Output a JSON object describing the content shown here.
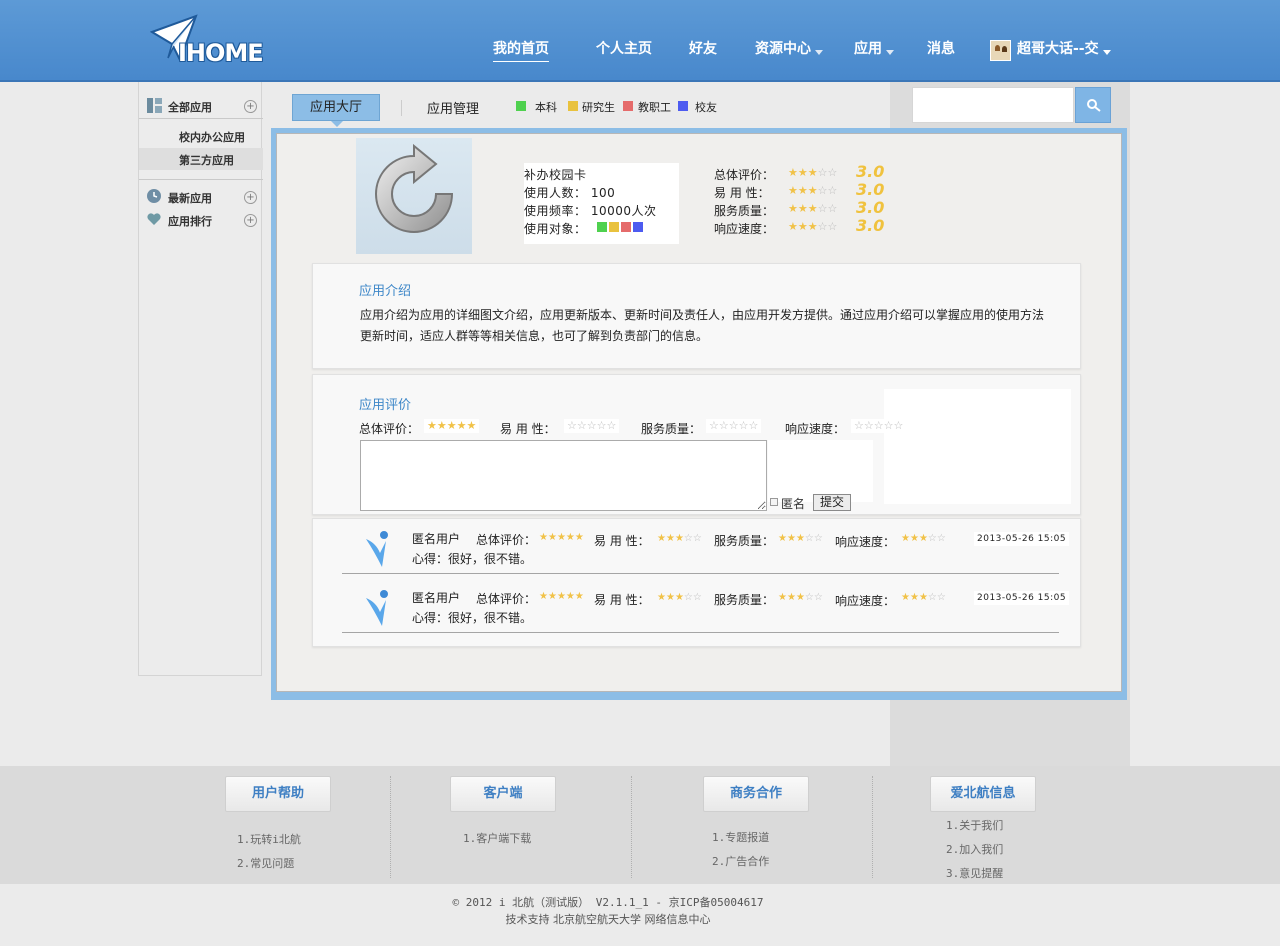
{
  "header": {
    "nav": [
      {
        "label": "我的首页",
        "active": true
      },
      {
        "label": "个人主页"
      },
      {
        "label": "好友"
      },
      {
        "label": "资源中心",
        "dropdown": true
      },
      {
        "label": "应用",
        "dropdown": true
      },
      {
        "label": "消息"
      }
    ],
    "logo_text": "IHOME",
    "user_name": "超哥大话--交",
    "colors": {
      "bar": "#4a8ad0",
      "accent": "#8cbde6"
    }
  },
  "sidebar": {
    "all_apps": "全部应用",
    "sub_items": [
      "校内办公应用",
      "第三方应用"
    ],
    "new_apps": "最新应用",
    "ranking": "应用排行"
  },
  "tabs": {
    "hall": "应用大厅",
    "manage": "应用管理",
    "legend": [
      {
        "label": "本科",
        "color": "#4fd14f"
      },
      {
        "label": "研究生",
        "color": "#e9c23e"
      },
      {
        "label": "教职工",
        "color": "#e56b6b"
      },
      {
        "label": "校友",
        "color": "#4d5bf0"
      }
    ]
  },
  "app": {
    "name": "补办校园卡",
    "users_label": "使用人数：",
    "users_value": "100",
    "freq_label": "使用频率：",
    "freq_value": "10000人次",
    "target_label": "使用对象：",
    "ratings": [
      {
        "label": "总体评价：",
        "stars": 3,
        "score": "3.0"
      },
      {
        "label": "易 用 性：",
        "stars": 3,
        "score": "3.0"
      },
      {
        "label": "服务质量：",
        "stars": 3,
        "score": "3.0"
      },
      {
        "label": "响应速度：",
        "stars": 3,
        "score": "3.0"
      }
    ]
  },
  "intro": {
    "title": "应用介绍",
    "text": "应用介绍为应用的详细图文介绍，应用更新版本、更新时间及责任人，由应用开发方提供。通过应用介绍可以掌握应用的使用方法更新时间，适应人群等等相关信息，也可了解到负责部门的信息。"
  },
  "evaluation": {
    "title": "应用评价",
    "fields": [
      {
        "label": "总体评价：",
        "stars": 5
      },
      {
        "label": "易 用 性：",
        "stars": 0
      },
      {
        "label": "服务质量：",
        "stars": 0
      },
      {
        "label": "响应速度：",
        "stars": 0
      }
    ],
    "anonymous_label": "匿名",
    "submit_label": "提交"
  },
  "reviews": [
    {
      "user": "匿名用户",
      "overall_label": "总体评价：",
      "overall": 5,
      "usability_label": "易 用 性：",
      "usability": 3,
      "service_label": "服务质量：",
      "service": 3,
      "speed_label": "响应速度：",
      "speed": 3,
      "time": "2013-05-26 15:05",
      "body": "心得：很好，很不错。"
    },
    {
      "user": "匿名用户",
      "overall_label": "总体评价：",
      "overall": 5,
      "usability_label": "易 用 性：",
      "usability": 3,
      "service_label": "服务质量：",
      "service": 3,
      "speed_label": "响应速度：",
      "speed": 3,
      "time": "2013-05-26 15:05",
      "body": "心得：很好，很不错。"
    }
  ],
  "footer": {
    "columns": [
      {
        "title": "用户帮助",
        "links": [
          "1.玩转i北航",
          "2.常见问题"
        ]
      },
      {
        "title": "客户端",
        "links": [
          "1.客户端下载"
        ]
      },
      {
        "title": "商务合作",
        "links": [
          "1.专题报道",
          "2.广告合作"
        ]
      },
      {
        "title": "爱北航信息",
        "links": [
          "1.关于我们",
          "2.加入我们",
          "3.意见提醒"
        ]
      }
    ],
    "copyright": "© 2012 i 北航（测试版） V2.1.1_1 - 京ICP备05004617",
    "support": "技术支持 北京航空航天大学 网络信息中心"
  },
  "search": {
    "placeholder": ""
  }
}
